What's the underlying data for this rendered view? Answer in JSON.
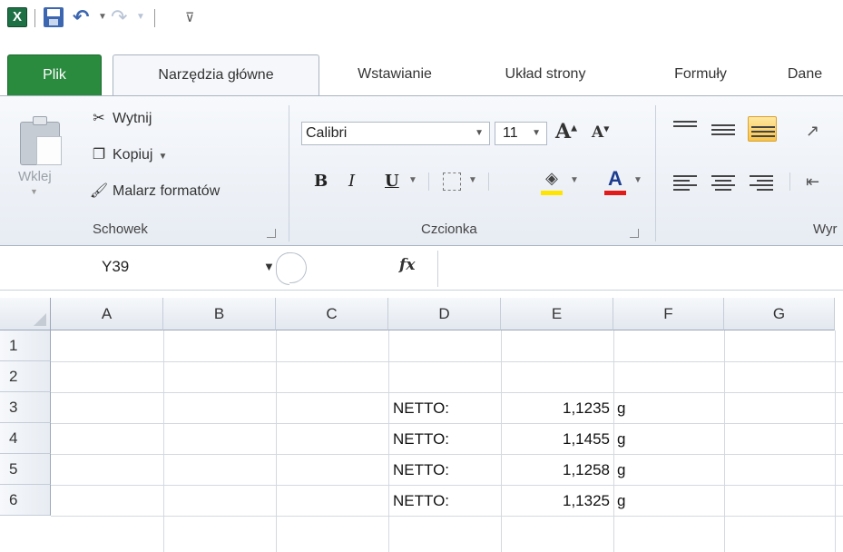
{
  "quick_access": {
    "app_icon": "excel-icon",
    "save_icon": "save-icon",
    "undo_icon": "undo-icon",
    "redo_icon": "redo-icon",
    "customize_icon": "customize-toolbar-icon"
  },
  "tabs": [
    {
      "label": "Plik"
    },
    {
      "label": "Narzędzia główne"
    },
    {
      "label": "Wstawianie"
    },
    {
      "label": "Układ strony"
    },
    {
      "label": "Formuły"
    },
    {
      "label": "Dane"
    }
  ],
  "ribbon": {
    "clipboard": {
      "paste_label": "Wklej",
      "cut_label": "Wytnij",
      "copy_label": "Kopiuj",
      "format_painter_label": "Malarz formatów",
      "group_label": "Schowek"
    },
    "font": {
      "font_name": "Calibri",
      "font_size": "11",
      "bold": "B",
      "italic": "I",
      "underline": "U",
      "font_color_glyph": "A",
      "grow_glyph": "A",
      "shrink_glyph": "A",
      "group_label": "Czcionka",
      "fill_color": "#ffe400",
      "text_color": "#e21a1a"
    },
    "alignment": {
      "group_label_partial": "Wyr"
    }
  },
  "formula_bar": {
    "name_box": "Y39",
    "fx_label": "fx",
    "formula": ""
  },
  "sheet": {
    "columns": [
      "A",
      "B",
      "C",
      "D",
      "E",
      "F",
      "G"
    ],
    "rows": [
      "1",
      "2",
      "3",
      "4",
      "5",
      "6"
    ],
    "cells": [
      {
        "ref": "D3",
        "value": "NETTO:"
      },
      {
        "ref": "E3",
        "value": "1,1235"
      },
      {
        "ref": "F3",
        "value": "g"
      },
      {
        "ref": "D4",
        "value": "NETTO:"
      },
      {
        "ref": "E4",
        "value": "1,1455"
      },
      {
        "ref": "F4",
        "value": "g"
      },
      {
        "ref": "D5",
        "value": "NETTO:"
      },
      {
        "ref": "E5",
        "value": "1,1258"
      },
      {
        "ref": "F5",
        "value": "g"
      },
      {
        "ref": "D6",
        "value": "NETTO:"
      },
      {
        "ref": "E6",
        "value": "1,1325"
      },
      {
        "ref": "F6",
        "value": "g"
      }
    ]
  }
}
